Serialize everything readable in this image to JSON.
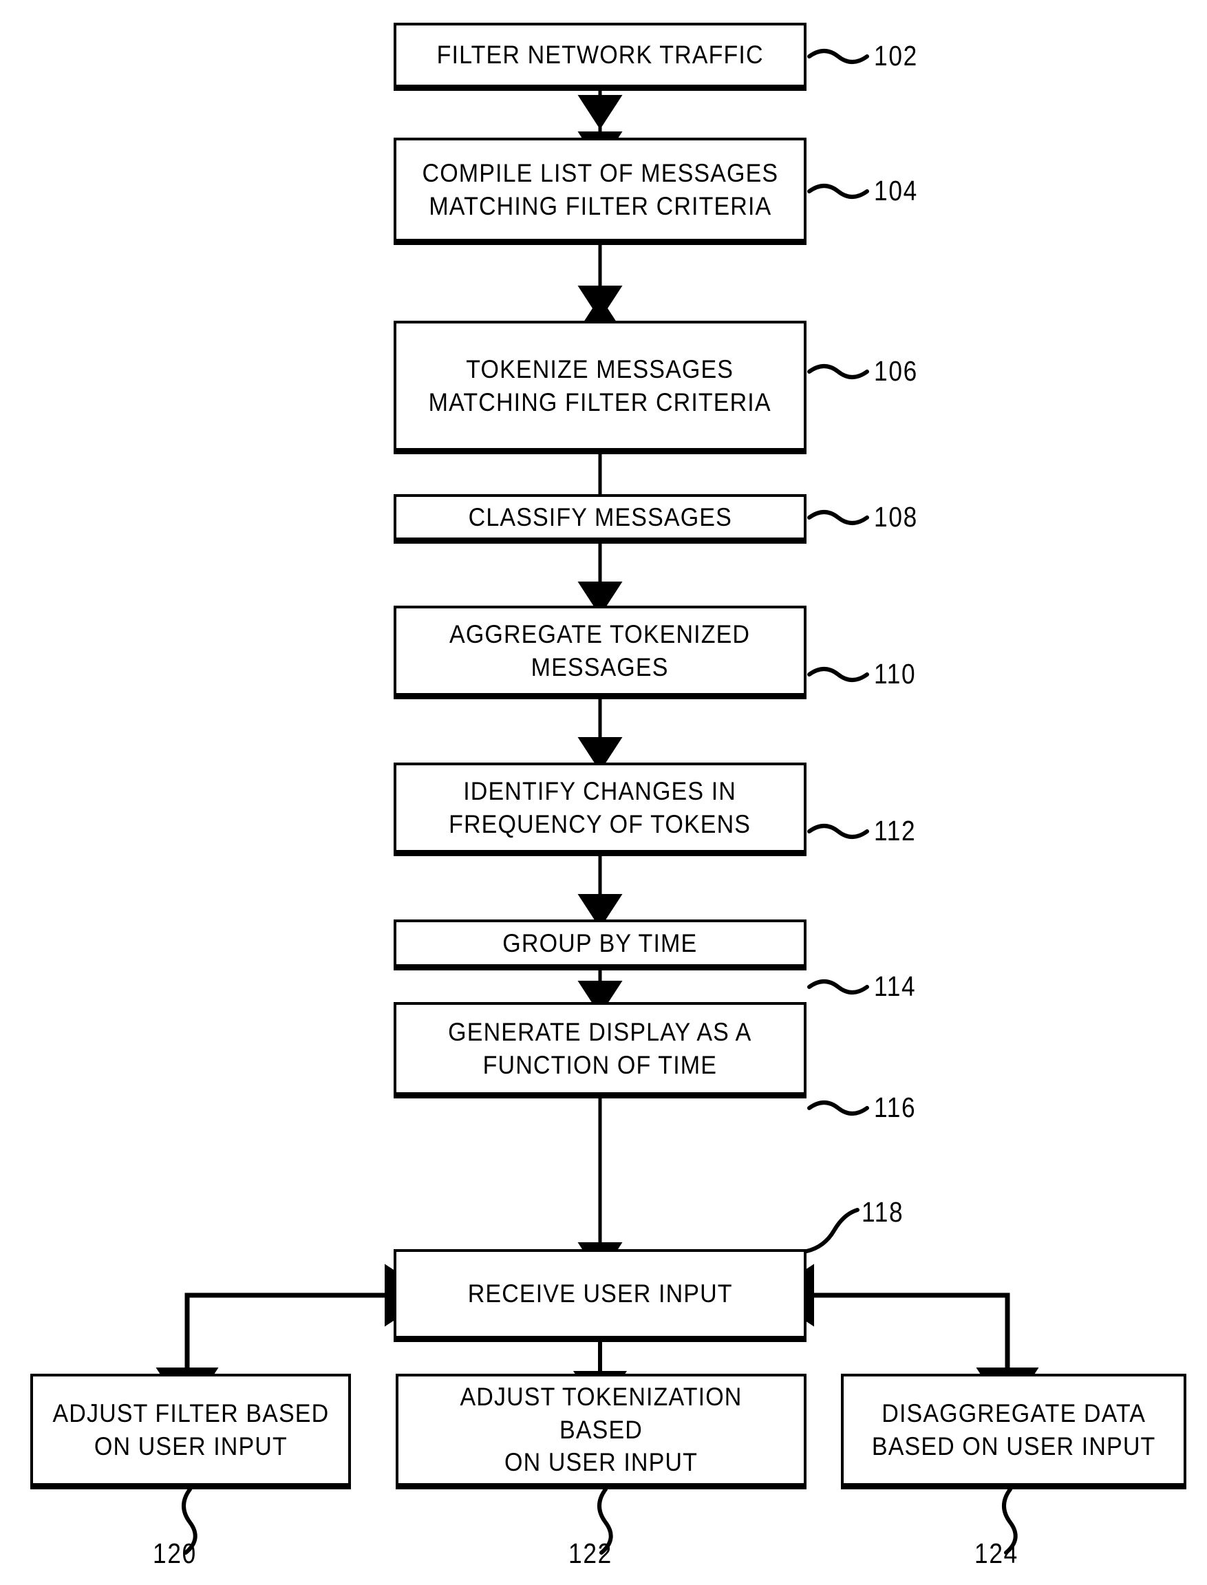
{
  "figure": {
    "type": "patent-flowchart",
    "orientation": "vertical",
    "background_color": "#ffffff",
    "line_color": "#000000"
  },
  "nodes": [
    {
      "ref": "102",
      "label": "FILTER NETWORK TRAFFIC"
    },
    {
      "ref": "104",
      "label": "COMPILE LIST OF MESSAGES\nMATCHING FILTER CRITERIA"
    },
    {
      "ref": "106",
      "label": "TOKENIZE MESSAGES\nMATCHING FILTER CRITERIA"
    },
    {
      "ref": "108",
      "label": "CLASSIFY MESSAGES"
    },
    {
      "ref": "110",
      "label": "AGGREGATE TOKENIZED\nMESSAGES"
    },
    {
      "ref": "112",
      "label": "IDENTIFY CHANGES IN\nFREQUENCY OF TOKENS"
    },
    {
      "ref": "114",
      "label": "GROUP BY TIME"
    },
    {
      "ref": "116",
      "label": "GENERATE DISPLAY AS A\nFUNCTION OF TIME"
    },
    {
      "ref": "118",
      "label": "RECEIVE USER INPUT"
    },
    {
      "ref": "120",
      "label": "ADJUST FILTER BASED\nON USER INPUT"
    },
    {
      "ref": "122",
      "label": "ADJUST TOKENIZATION BASED\nON USER INPUT"
    },
    {
      "ref": "124",
      "label": "DISAGGREGATE DATA\nBASED ON USER INPUT"
    }
  ],
  "ref_labels": {
    "r102": "102",
    "r104": "104",
    "r106": "106",
    "r108": "108",
    "r110": "110",
    "r112": "112",
    "r114": "114",
    "r116": "116",
    "r118": "118",
    "r120": "120",
    "r122": "122",
    "r124": "124"
  },
  "node_labels": {
    "n102": "FILTER NETWORK TRAFFIC",
    "n104": "COMPILE LIST OF MESSAGES\nMATCHING FILTER CRITERIA",
    "n106": "TOKENIZE MESSAGES\nMATCHING FILTER CRITERIA",
    "n108": "CLASSIFY MESSAGES",
    "n110": "AGGREGATE TOKENIZED\nMESSAGES",
    "n112": "IDENTIFY CHANGES IN\nFREQUENCY OF TOKENS",
    "n114": "GROUP BY TIME",
    "n116": "GENERATE DISPLAY AS A\nFUNCTION OF TIME",
    "n118": "RECEIVE USER INPUT",
    "n120": "ADJUST FILTER BASED\nON USER INPUT",
    "n122": "ADJUST TOKENIZATION BASED\nON USER INPUT",
    "n124": "DISAGGREGATE DATA\nBASED ON USER INPUT"
  },
  "edges": [
    {
      "from": "102",
      "to": "104",
      "direction": "down"
    },
    {
      "from": "104",
      "to": "106",
      "direction": "down"
    },
    {
      "from": "106",
      "to": "108",
      "direction": "down"
    },
    {
      "from": "108",
      "to": "110",
      "direction": "down"
    },
    {
      "from": "110",
      "to": "112",
      "direction": "down"
    },
    {
      "from": "112",
      "to": "114",
      "direction": "down"
    },
    {
      "from": "114",
      "to": "116",
      "direction": "down"
    },
    {
      "from": "116",
      "to": "118",
      "direction": "down"
    },
    {
      "from": "118",
      "to": "120",
      "direction": "left-then-down"
    },
    {
      "from": "118",
      "to": "122",
      "direction": "bidirectional-vertical"
    },
    {
      "from": "118",
      "to": "124",
      "direction": "right-then-down"
    }
  ]
}
